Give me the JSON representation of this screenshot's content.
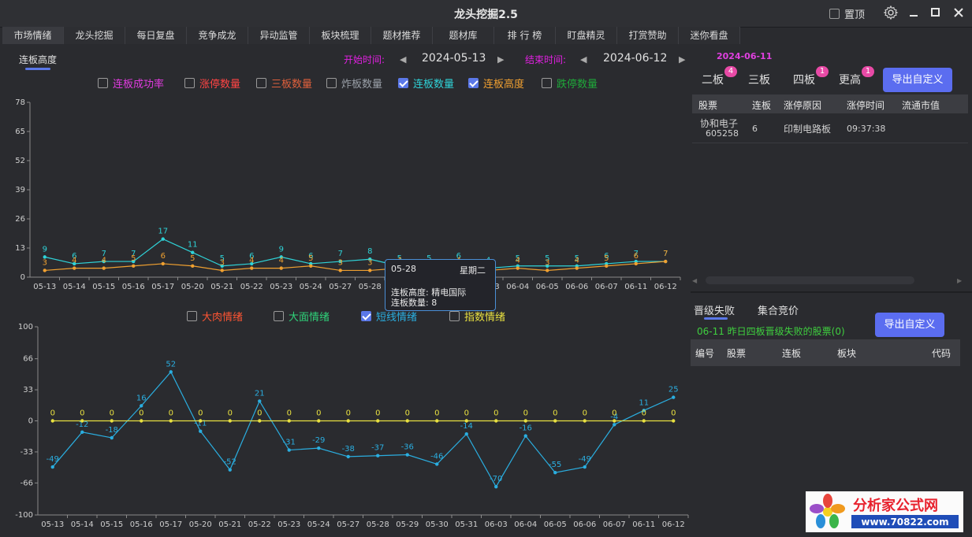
{
  "window": {
    "title": "龙头挖掘2.5",
    "pin_label": "置顶",
    "pin_checked": false
  },
  "tabs": [
    "市场情绪",
    "龙头挖掘",
    "每日复盘",
    "竞争成龙",
    "异动监管",
    "板块梳理",
    "题材推荐",
    "题材库",
    "排 行 榜",
    "盯盘精灵",
    "打赏赞助",
    "迷你看盘"
  ],
  "active_tab": 0,
  "subtab": "连板高度",
  "date_range": {
    "start_label": "开始时间:",
    "start": "2024-05-13",
    "end_label": "结束时间:",
    "end": "2024-06-12"
  },
  "top_legend": [
    {
      "label": "连板成功率",
      "checked": false,
      "color": "#e23be0"
    },
    {
      "label": "涨停数量",
      "checked": false,
      "color": "#ff4444"
    },
    {
      "label": "三板数量",
      "checked": false,
      "color": "#e0603c"
    },
    {
      "label": "炸板数量",
      "checked": false,
      "color": "#9aa0a8"
    },
    {
      "label": "连板数量",
      "checked": true,
      "color": "#2fd3d8"
    },
    {
      "label": "连板高度",
      "checked": true,
      "color": "#f0a030"
    },
    {
      "label": "跌停数量",
      "checked": false,
      "color": "#1fa83a"
    }
  ],
  "bottom_legend": [
    {
      "label": "大肉情绪",
      "checked": false,
      "color": "#ff5533"
    },
    {
      "label": "大面情绪",
      "checked": false,
      "color": "#2fd37a"
    },
    {
      "label": "短线情绪",
      "checked": true,
      "color": "#2aaee0"
    },
    {
      "label": "指数情绪",
      "checked": false,
      "color": "#e8e040"
    }
  ],
  "chart_data": [
    {
      "type": "line",
      "categories": [
        "05-13",
        "05-14",
        "05-15",
        "05-16",
        "05-17",
        "05-20",
        "05-21",
        "05-22",
        "05-23",
        "05-24",
        "05-27",
        "05-28",
        "05-29",
        "05-30",
        "05-31",
        "06-03",
        "06-04",
        "06-05",
        "06-06",
        "06-07",
        "06-11",
        "06-12"
      ],
      "yticks": [
        0,
        13,
        26,
        39,
        52,
        65,
        78
      ],
      "ylim": [
        0,
        78
      ],
      "series": [
        {
          "name": "连板数量",
          "color": "#2fd3d8",
          "values": [
            9,
            6,
            7,
            7,
            17,
            11,
            5,
            6,
            9,
            6,
            7,
            8,
            5,
            5,
            6,
            4,
            5,
            5,
            5,
            6,
            7,
            7
          ]
        },
        {
          "name": "连板高度",
          "color": "#f0a030",
          "values": [
            3,
            4,
            4,
            5,
            6,
            5,
            3,
            4,
            4,
            5,
            3,
            3,
            4,
            3,
            4,
            3,
            4,
            3,
            4,
            5,
            6,
            7
          ]
        }
      ]
    },
    {
      "type": "line",
      "categories": [
        "05-13",
        "05-14",
        "05-15",
        "05-16",
        "05-17",
        "05-20",
        "05-21",
        "05-22",
        "05-23",
        "05-24",
        "05-27",
        "05-28",
        "05-29",
        "05-30",
        "05-31",
        "06-03",
        "06-04",
        "06-05",
        "06-06",
        "06-07",
        "06-11",
        "06-12"
      ],
      "yticks": [
        -100,
        -66,
        -33,
        0,
        33,
        66,
        100
      ],
      "ylim": [
        -100,
        100
      ],
      "series": [
        {
          "name": "短线情绪",
          "color": "#2aaee0",
          "values": [
            -49,
            -12,
            -18,
            16,
            52,
            -11,
            -52,
            21,
            -31,
            -29,
            -38,
            -37,
            -36,
            -46,
            -14,
            -70,
            -16,
            -55,
            -49,
            -4,
            11,
            25
          ]
        },
        {
          "name": "指数情绪",
          "color": "#e8e040",
          "values": [
            0,
            0,
            0,
            0,
            0,
            0,
            0,
            0,
            0,
            0,
            0,
            0,
            0,
            0,
            0,
            0,
            0,
            0,
            0,
            0,
            0,
            0
          ]
        }
      ]
    }
  ],
  "tooltip": {
    "date": "05-28",
    "weekday": "星期二",
    "line1": "连板高度: 精电国际",
    "line2": "连板数量: 8"
  },
  "right_panel": {
    "date": "2024-06-11",
    "tabs": [
      {
        "label": "二板",
        "badge": "4"
      },
      {
        "label": "三板",
        "badge": ""
      },
      {
        "label": "四板",
        "badge": "1"
      },
      {
        "label": "更高",
        "badge": "1"
      }
    ],
    "export_label": "导出自定义",
    "columns": [
      "股票",
      "连板",
      "涨停原因",
      "涨停时间",
      "流通市值"
    ],
    "rows": [
      {
        "name": "协和电子",
        "code": "605258",
        "boards": "6",
        "reason": "印制电路板",
        "time": "09:37:38"
      }
    ]
  },
  "lower_right": {
    "tabs": [
      "晋级失败",
      "集合竞价"
    ],
    "notice": "06-11  昨日四板晋级失败的股票(0)",
    "export_label": "导出自定义",
    "columns": [
      "编号",
      "股票",
      "连板",
      "板块",
      "代码"
    ]
  },
  "logo": {
    "text": "分析家公式网",
    "url_text": "www.70822.com"
  }
}
